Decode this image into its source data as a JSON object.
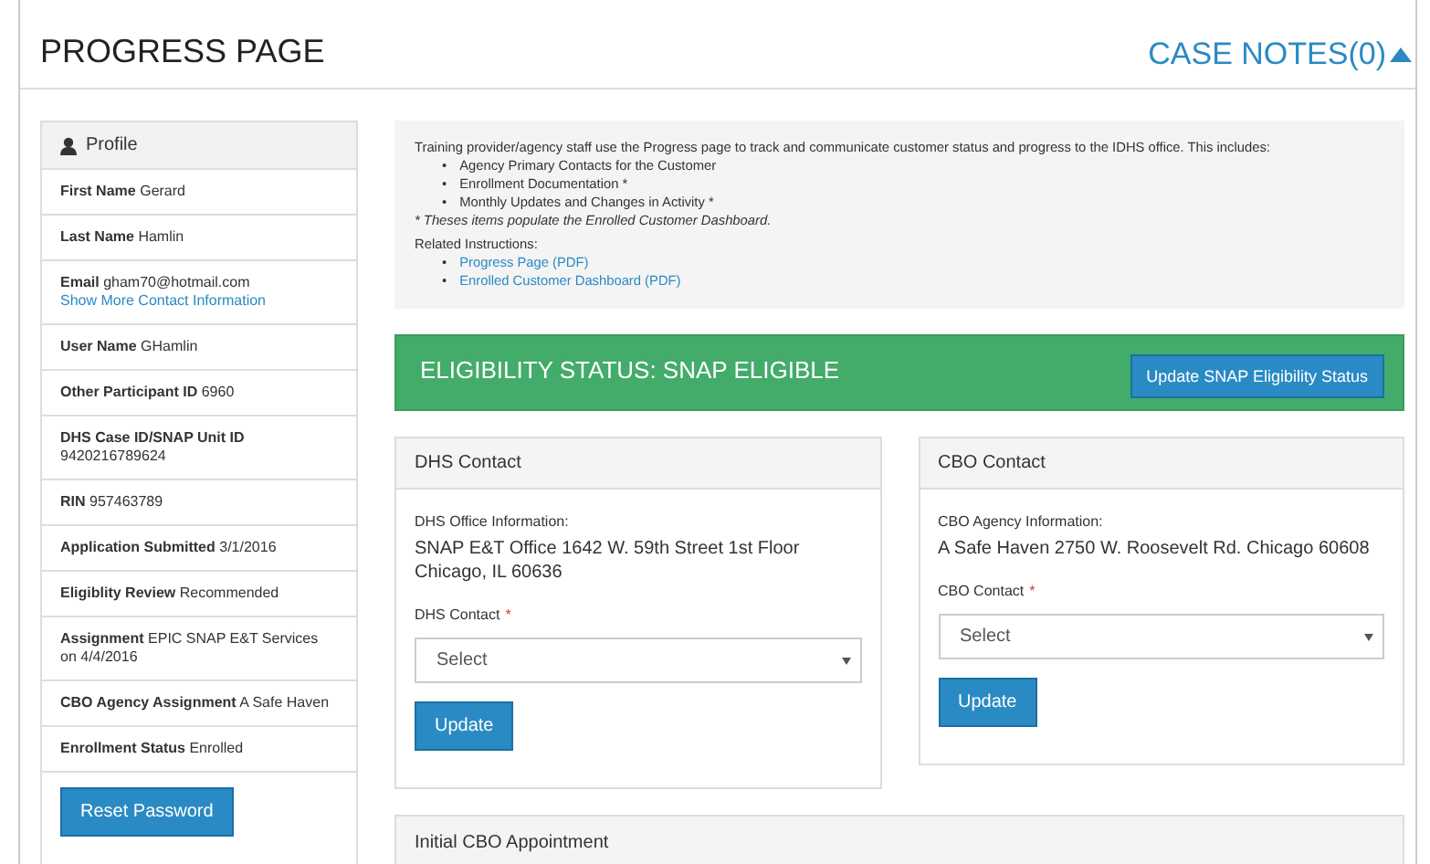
{
  "page_title": "PROGRESS PAGE",
  "case_notes": {
    "label": "CASE NOTES(0)",
    "expanded": true
  },
  "profile": {
    "header": "Profile",
    "fields": [
      {
        "label": "First Name",
        "value": "Gerard"
      },
      {
        "label": "Last Name",
        "value": "Hamlin"
      },
      {
        "label": "Email",
        "value": "gham70@hotmail.com",
        "link": "Show More Contact Information"
      },
      {
        "label": "User Name",
        "value": "GHamlin"
      },
      {
        "label": "Other Participant ID",
        "value": "6960"
      },
      {
        "label": "DHS Case ID/SNAP Unit ID",
        "value": "9420216789624"
      },
      {
        "label": "RIN",
        "value": "957463789"
      },
      {
        "label": "Application Submitted",
        "value": "3/1/2016"
      },
      {
        "label": "Eligiblity Review",
        "value": "Recommended"
      },
      {
        "label": "Assignment",
        "value": "EPIC SNAP E&T Services on 4/4/2016"
      },
      {
        "label": "CBO Agency Assignment",
        "value": "A Safe Haven"
      },
      {
        "label": "Enrollment Status",
        "value": "Enrolled"
      }
    ],
    "button": "Reset Password"
  },
  "info": {
    "bullet": "•",
    "intro": "Training provider/agency staff use the Progress page to track and communicate customer status and progress to the IDHS office. This includes:",
    "items": [
      "Agency Primary Contacts for the Customer",
      "Enrollment Documentation *",
      "Monthly Updates and Changes in Activity *"
    ],
    "note": "* Theses items populate the Enrolled Customer Dashboard.",
    "related_label": "Related Instructions:",
    "links": [
      "Progress Page (PDF)",
      "Enrolled Customer Dashboard (PDF)"
    ]
  },
  "eligibility": {
    "status": "ELIGIBILITY STATUS: SNAP ELIGIBLE",
    "button": "Update SNAP Eligibility Status"
  },
  "contacts": [
    {
      "title": "DHS Contact",
      "info_label": "DHS Office Information:",
      "info_text": "SNAP E&T Office 1642 W. 59th Street 1st Floor Chicago, IL 60636",
      "field_label": "DHS Contact",
      "required_mark": "*",
      "value": "Select",
      "button": "Update"
    },
    {
      "title": "CBO Contact",
      "info_label": "CBO Agency Information:",
      "info_text": "A Safe Haven 2750 W. Roosevelt Rd. Chicago 60608",
      "field_label": "CBO Contact",
      "required_mark": "*",
      "value": "Select",
      "button": "Update"
    }
  ],
  "bottom_panel": {
    "title": "Initial CBO Appointment"
  }
}
